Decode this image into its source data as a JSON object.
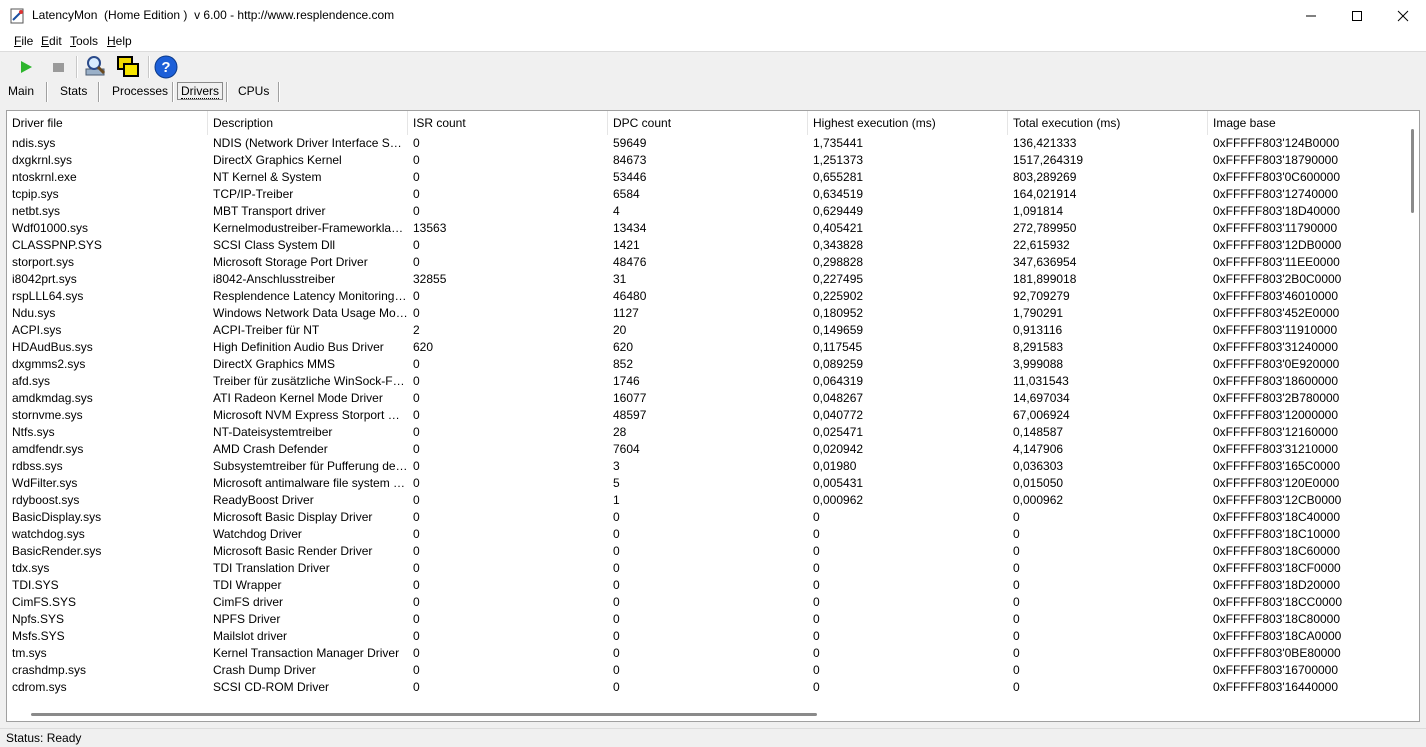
{
  "window": {
    "title": "LatencyMon  (Home Edition )  v 6.00 - http://www.resplendence.com",
    "minimize": "—",
    "maximize": "▢",
    "close": "✕"
  },
  "menu": [
    {
      "u": "F",
      "rest": "ile"
    },
    {
      "u": "E",
      "rest": "dit"
    },
    {
      "u": "T",
      "rest": "ools"
    },
    {
      "u": "H",
      "rest": "elp"
    }
  ],
  "toolbar": {
    "start_icon": "play-icon",
    "stop_icon": "stop-icon",
    "analyze_icon": "magnifier-icon",
    "windows_icon": "window-icon",
    "help_icon": "help-icon",
    "accent_green": "#2db52d",
    "accent_blue": "#1c5fd8"
  },
  "tabs": [
    "Main",
    "Stats",
    "Processes",
    "Drivers",
    "CPUs"
  ],
  "active_tab": "Drivers",
  "columns": [
    "Driver file",
    "Description",
    "ISR count",
    "DPC count",
    "Highest execution (ms)",
    "Total execution (ms)",
    "Image base"
  ],
  "rows": [
    [
      "ndis.sys",
      "NDIS (Network Driver Interface Spe...",
      "0",
      "59649",
      "1,735441",
      "136,421333",
      "0xFFFFF803'124B0000"
    ],
    [
      "dxgkrnl.sys",
      "DirectX Graphics Kernel",
      "0",
      "84673",
      "1,251373",
      "1517,264319",
      "0xFFFFF803'18790000"
    ],
    [
      "ntoskrnl.exe",
      "NT Kernel & System",
      "0",
      "53446",
      "0,655281",
      "803,289269",
      "0xFFFFF803'0C600000"
    ],
    [
      "tcpip.sys",
      "TCP/IP-Treiber",
      "0",
      "6584",
      "0,634519",
      "164,021914",
      "0xFFFFF803'12740000"
    ],
    [
      "netbt.sys",
      "MBT Transport driver",
      "0",
      "4",
      "0,629449",
      "1,091814",
      "0xFFFFF803'18D40000"
    ],
    [
      "Wdf01000.sys",
      "Kernelmodustreiber-Frameworklaufzeit",
      "13563",
      "13434",
      "0,405421",
      "272,789950",
      "0xFFFFF803'11790000"
    ],
    [
      "CLASSPNP.SYS",
      "SCSI Class System Dll",
      "0",
      "1421",
      "0,343828",
      "22,615932",
      "0xFFFFF803'12DB0000"
    ],
    [
      "storport.sys",
      "Microsoft Storage Port Driver",
      "0",
      "48476",
      "0,298828",
      "347,636954",
      "0xFFFFF803'11EE0000"
    ],
    [
      "i8042prt.sys",
      "i8042-Anschlusstreiber",
      "32855",
      "31",
      "0,227495",
      "181,899018",
      "0xFFFFF803'2B0C0000"
    ],
    [
      "rspLLL64.sys",
      "Resplendence Latency Monitoring a...",
      "0",
      "46480",
      "0,225902",
      "92,709279",
      "0xFFFFF803'46010000"
    ],
    [
      "Ndu.sys",
      "Windows Network Data Usage Monit...",
      "0",
      "1127",
      "0,180952",
      "1,790291",
      "0xFFFFF803'452E0000"
    ],
    [
      "ACPI.sys",
      "ACPI-Treiber für NT",
      "2",
      "20",
      "0,149659",
      "0,913116",
      "0xFFFFF803'11910000"
    ],
    [
      "HDAudBus.sys",
      "High Definition Audio Bus Driver",
      "620",
      "620",
      "0,117545",
      "8,291583",
      "0xFFFFF803'31240000"
    ],
    [
      "dxgmms2.sys",
      "DirectX Graphics MMS",
      "0",
      "852",
      "0,089259",
      "3,999088",
      "0xFFFFF803'0E920000"
    ],
    [
      "afd.sys",
      "Treiber für zusätzliche WinSock-Fun...",
      "0",
      "1746",
      "0,064319",
      "11,031543",
      "0xFFFFF803'18600000"
    ],
    [
      "amdkmdag.sys",
      "ATI Radeon Kernel Mode Driver",
      "0",
      "16077",
      "0,048267",
      "14,697034",
      "0xFFFFF803'2B780000"
    ],
    [
      "stornvme.sys",
      "Microsoft NVM Express Storport Mini...",
      "0",
      "48597",
      "0,040772",
      "67,006924",
      "0xFFFFF803'12000000"
    ],
    [
      "Ntfs.sys",
      "NT-Dateisystemtreiber",
      "0",
      "28",
      "0,025471",
      "0,148587",
      "0xFFFFF803'12160000"
    ],
    [
      "amdfendr.sys",
      "AMD Crash Defender",
      "0",
      "7604",
      "0,020942",
      "4,147906",
      "0xFFFFF803'31210000"
    ],
    [
      "rdbss.sys",
      "Subsystemtreiber für Pufferung des...",
      "0",
      "3",
      "0,01980",
      "0,036303",
      "0xFFFFF803'165C0000"
    ],
    [
      "WdFilter.sys",
      "Microsoft antimalware file system filt...",
      "0",
      "5",
      "0,005431",
      "0,015050",
      "0xFFFFF803'120E0000"
    ],
    [
      "rdyboost.sys",
      "ReadyBoost Driver",
      "0",
      "1",
      "0,000962",
      "0,000962",
      "0xFFFFF803'12CB0000"
    ],
    [
      "BasicDisplay.sys",
      "Microsoft Basic Display Driver",
      "0",
      "0",
      "0",
      "0",
      "0xFFFFF803'18C40000"
    ],
    [
      "watchdog.sys",
      "Watchdog Driver",
      "0",
      "0",
      "0",
      "0",
      "0xFFFFF803'18C10000"
    ],
    [
      "BasicRender.sys",
      "Microsoft Basic Render Driver",
      "0",
      "0",
      "0",
      "0",
      "0xFFFFF803'18C60000"
    ],
    [
      "tdx.sys",
      "TDI Translation Driver",
      "0",
      "0",
      "0",
      "0",
      "0xFFFFF803'18CF0000"
    ],
    [
      "TDI.SYS",
      "TDI Wrapper",
      "0",
      "0",
      "0",
      "0",
      "0xFFFFF803'18D20000"
    ],
    [
      "CimFS.SYS",
      "CimFS driver",
      "0",
      "0",
      "0",
      "0",
      "0xFFFFF803'18CC0000"
    ],
    [
      "Npfs.SYS",
      "NPFS Driver",
      "0",
      "0",
      "0",
      "0",
      "0xFFFFF803'18C80000"
    ],
    [
      "Msfs.SYS",
      "Mailslot driver",
      "0",
      "0",
      "0",
      "0",
      "0xFFFFF803'18CA0000"
    ],
    [
      "tm.sys",
      "Kernel Transaction Manager Driver",
      "0",
      "0",
      "0",
      "0",
      "0xFFFFF803'0BE80000"
    ],
    [
      "crashdmp.sys",
      "Crash Dump Driver",
      "0",
      "0",
      "0",
      "0",
      "0xFFFFF803'16700000"
    ],
    [
      "cdrom.sys",
      "SCSI CD-ROM Driver",
      "0",
      "0",
      "0",
      "0",
      "0xFFFFF803'16440000"
    ]
  ],
  "status": "Status: Ready"
}
